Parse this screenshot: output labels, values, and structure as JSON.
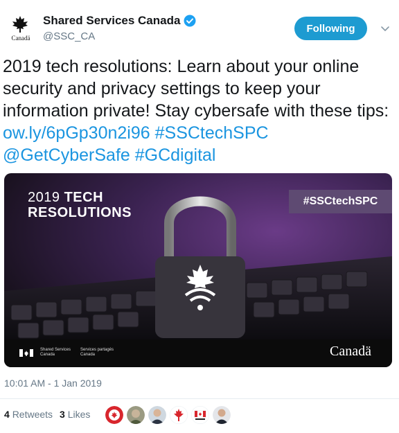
{
  "account": {
    "name": "Shared Services Canada",
    "handle": "@SSC_CA",
    "avatar_wordmark": "Canadä",
    "verified_icon": "verified-badge-icon"
  },
  "follow": {
    "label": "Following",
    "menu_icon": "chevron-down-icon"
  },
  "tweet": {
    "text": "2019 tech resolutions: Learn about your online security and privacy settings to keep your information private! Stay cybersafe with these tips: ",
    "link": "ow.ly/6pGp30n2i96",
    "hashtag1": "#SSCtechSPC",
    "mention": "@GetCyberSafe",
    "hashtag2": "#GCdigital"
  },
  "media": {
    "title_year": "2019",
    "title_tech": "TECH",
    "title_resolutions": "RESOLUTIONS",
    "hashtag_badge": "#SSCtechSPC",
    "footer_en_1": "Shared Services",
    "footer_en_2": "Canada",
    "footer_fr_1": "Services partagés",
    "footer_fr_2": "Canada",
    "wordmark": "Canadä"
  },
  "timestamp": "10:01 AM - 1 Jan 2019",
  "stats": {
    "retweets_count": "4",
    "retweets_label": "Retweets",
    "likes_count": "3",
    "likes_label": "Likes"
  },
  "colors": {
    "accent": "#1b95e0",
    "follow_button": "#1d9bd1",
    "muted": "#657786"
  }
}
